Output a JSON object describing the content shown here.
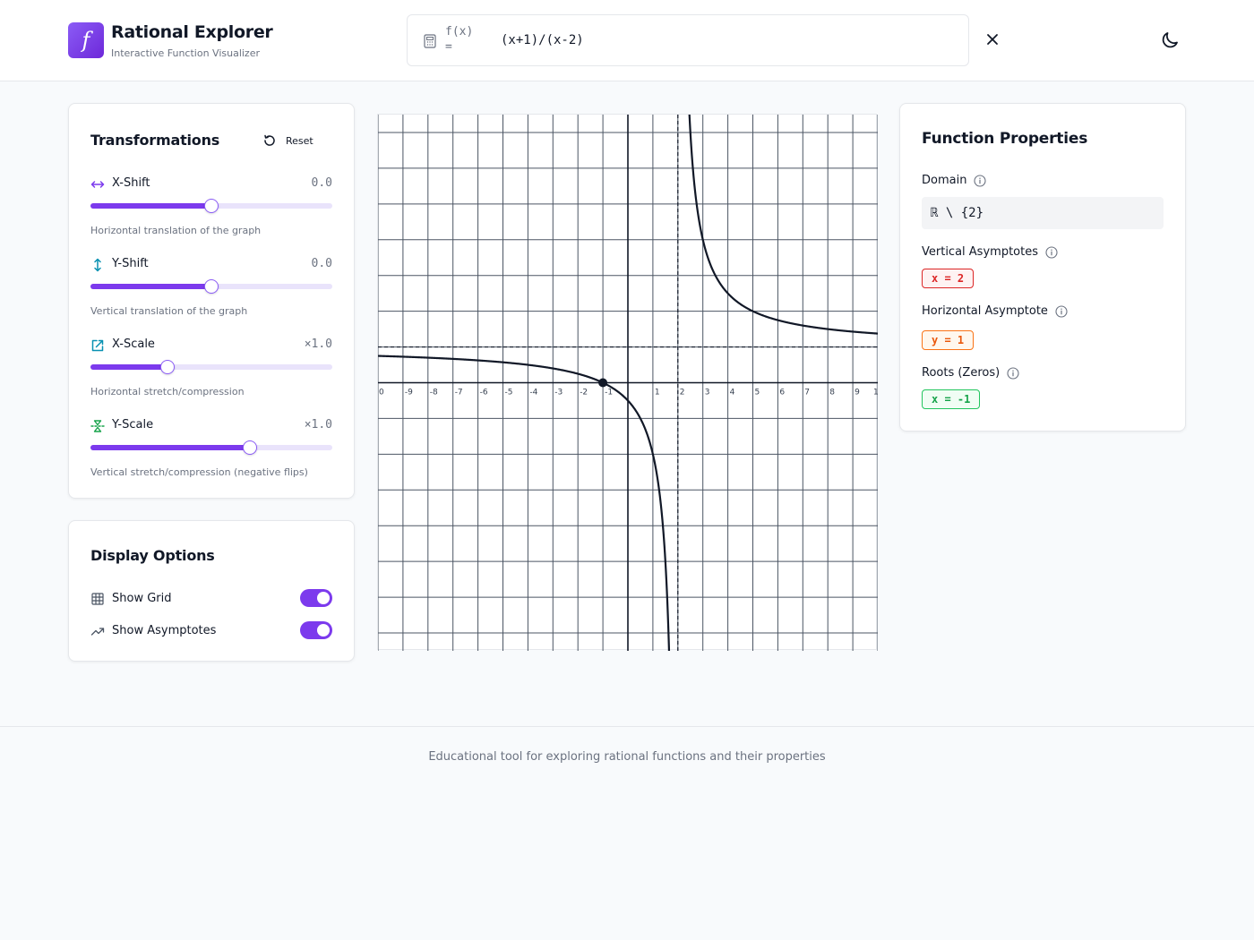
{
  "app": {
    "logo_glyph": "f",
    "title": "Rational Explorer",
    "subtitle": "Interactive Function Visualizer"
  },
  "function_input": {
    "label": "f(x) =",
    "value": "(x+1)/(x-2)"
  },
  "transformations": {
    "title": "Transformations",
    "reset_label": "Reset",
    "controls": [
      {
        "name": "X-Shift",
        "value": "0.0",
        "description": "Horizontal translation of the graph",
        "fraction": 0.5,
        "icon": "arrows-horizontal-icon",
        "color": "#7c3aed"
      },
      {
        "name": "Y-Shift",
        "value": "0.0",
        "description": "Vertical translation of the graph",
        "fraction": 0.5,
        "icon": "arrows-vertical-icon",
        "color": "#0891b2"
      },
      {
        "name": "X-Scale",
        "value": "×1.0",
        "description": "Horizontal stretch/compression",
        "fraction": 0.32,
        "icon": "scale-icon",
        "color": "#0891b2"
      },
      {
        "name": "Y-Scale",
        "value": "×1.0",
        "description": "Vertical stretch/compression (negative flips)",
        "fraction": 0.66,
        "icon": "flip-vertical-icon",
        "color": "#16a34a"
      }
    ]
  },
  "display_options": {
    "title": "Display Options",
    "options": [
      {
        "label": "Show Grid",
        "enabled": true,
        "icon": "grid-icon"
      },
      {
        "label": "Show Asymptotes",
        "enabled": true,
        "icon": "trending-icon"
      }
    ]
  },
  "chart_data": {
    "type": "line",
    "function": "(x+1)/(x-2)",
    "xlim": [
      -10,
      10
    ],
    "ylim": [
      -7.5,
      7.5
    ],
    "x_ticks": [
      "0",
      "-9",
      "-8",
      "-7",
      "-6",
      "-5",
      "-4",
      "-3",
      "-2",
      "-1",
      "",
      "1",
      "2",
      "3",
      "4",
      "5",
      "6",
      "7",
      "8",
      "9",
      "1"
    ],
    "grid": true,
    "vertical_asymptotes": [
      2
    ],
    "horizontal_asymptote": 1,
    "roots": [
      -1
    ],
    "highlighted_points": [
      {
        "x": -1,
        "y": 0
      }
    ]
  },
  "properties": {
    "title": "Function Properties",
    "domain_label": "Domain",
    "domain_value": "ℝ \\ {2}",
    "vertical_label": "Vertical Asymptotes",
    "vertical_values": [
      "x = 2"
    ],
    "horizontal_label": "Horizontal Asymptote",
    "horizontal_value": "y = 1",
    "roots_label": "Roots (Zeros)",
    "roots_values": [
      "x = -1"
    ]
  },
  "footer": {
    "text": "Educational tool for exploring rational functions and their properties"
  },
  "colors": {
    "accent": "#7c3aed",
    "vertical_asymptote": "#dc2626",
    "horizontal_asymptote": "#ea580c",
    "root": "#16a34a"
  }
}
